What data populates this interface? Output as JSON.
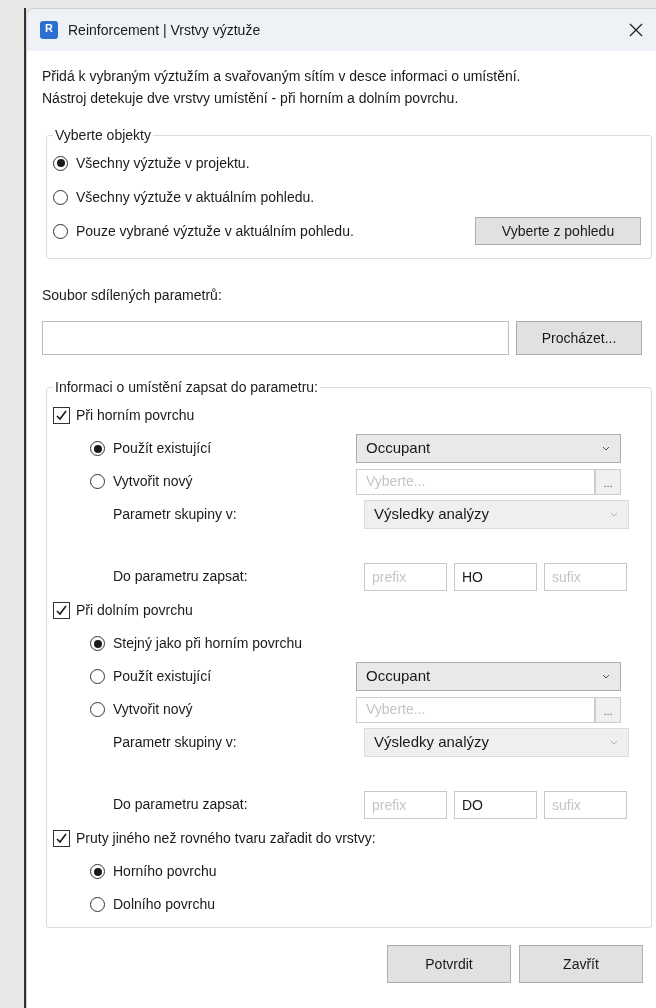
{
  "window": {
    "title": "Reinforcement | Vrstvy výztuže",
    "icon_letter": "R"
  },
  "description": [
    "Přidá k vybraným výztužím a svařovaným sítím v desce informaci o umístění.",
    "Nástroj detekuje dve vrstvy umístění - při horním a dolním povrchu."
  ],
  "select_group": {
    "title": "Vyberte objekty",
    "options": [
      {
        "label": "Všechny výztuže v projektu.",
        "selected": true
      },
      {
        "label": "Všechny výztuže v aktuálním pohledu.",
        "selected": false
      },
      {
        "label": "Pouze vybrané výztuže v aktuálním pohledu.",
        "selected": false
      }
    ],
    "button": "Vyberte z pohledu"
  },
  "shared_file": {
    "label": "Soubor sdílených parametrů:",
    "button": "Procházet..."
  },
  "write_group": {
    "title": "Informaci o umístění zapsat do parametru:",
    "sections": [
      {
        "label": "Při horním povrchu",
        "checked": true,
        "options": [
          {
            "label": "Použít existující",
            "selected": true,
            "control": {
              "kind": "dropdown",
              "value": "Occupant",
              "disabled": false
            }
          },
          {
            "label": "Vytvořit nový",
            "selected": false,
            "control": {
              "kind": "picker",
              "placeholder": "Vyberte...",
              "button": "..."
            }
          }
        ],
        "group_param": {
          "label": "Parametr skupiny v:",
          "value": "Výsledky analýzy",
          "disabled": true
        },
        "write_to": {
          "label": "Do parametru zapsat:",
          "prefix_placeholder": "prefix",
          "value": "HO",
          "suffix_placeholder": "sufix"
        }
      },
      {
        "label": "Při dolním povrchu",
        "checked": true,
        "options": [
          {
            "label": "Stejný jako při horním povrchu",
            "selected": true
          },
          {
            "label": "Použít existující",
            "selected": false,
            "control": {
              "kind": "dropdown",
              "value": "Occupant",
              "disabled": false
            }
          },
          {
            "label": "Vytvořit nový",
            "selected": false,
            "control": {
              "kind": "picker",
              "placeholder": "Vyberte...",
              "button": "..."
            }
          }
        ],
        "group_param": {
          "label": "Parametr skupiny v:",
          "value": "Výsledky analýzy",
          "disabled": true
        },
        "write_to": {
          "label": "Do parametru zapsat:",
          "prefix_placeholder": "prefix",
          "value": "DO",
          "suffix_placeholder": "sufix"
        }
      },
      {
        "label": "Pruty jiného než rovného tvaru zařadit do vrstvy:",
        "checked": true,
        "options": [
          {
            "label": "Horního povrchu",
            "selected": true
          },
          {
            "label": "Dolního povrchu",
            "selected": false
          }
        ]
      }
    ]
  },
  "buttons": [
    "Potvrdit",
    "Zavřít"
  ]
}
